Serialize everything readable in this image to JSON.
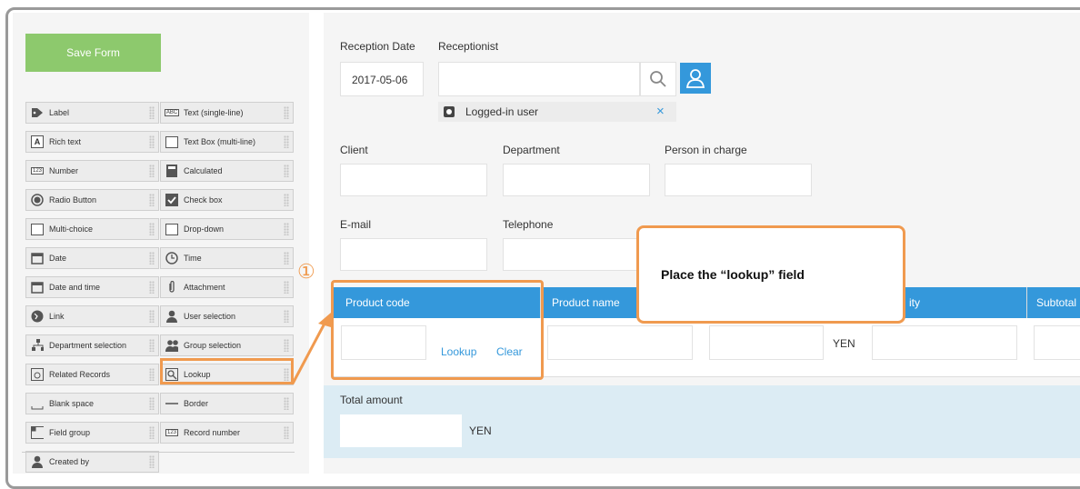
{
  "save_label": "Save Form",
  "palette": [
    {
      "label": "Label",
      "icon": "tag-icon"
    },
    {
      "label": "Text (single-line)",
      "icon": "text-single-icon"
    },
    {
      "label": "Rich text",
      "icon": "rich-text-icon"
    },
    {
      "label": "Text Box (multi-line)",
      "icon": "text-multi-icon"
    },
    {
      "label": "Number",
      "icon": "number-icon"
    },
    {
      "label": "Calculated",
      "icon": "calculator-icon"
    },
    {
      "label": "Radio Button",
      "icon": "radio-icon"
    },
    {
      "label": "Check box",
      "icon": "checkbox-icon"
    },
    {
      "label": "Multi-choice",
      "icon": "multi-choice-icon"
    },
    {
      "label": "Drop-down",
      "icon": "dropdown-icon"
    },
    {
      "label": "Date",
      "icon": "calendar-icon"
    },
    {
      "label": "Time",
      "icon": "clock-icon"
    },
    {
      "label": "Date and time",
      "icon": "calendar-time-icon"
    },
    {
      "label": "Attachment",
      "icon": "paperclip-icon"
    },
    {
      "label": "Link",
      "icon": "globe-icon"
    },
    {
      "label": "User selection",
      "icon": "user-icon"
    },
    {
      "label": "Department selection",
      "icon": "org-icon"
    },
    {
      "label": "Group selection",
      "icon": "group-icon"
    },
    {
      "label": "Related Records",
      "icon": "related-records-icon"
    },
    {
      "label": "Lookup",
      "icon": "lookup-icon"
    },
    {
      "label": "Blank space",
      "icon": "blank-space-icon"
    },
    {
      "label": "Border",
      "icon": "border-line-icon"
    },
    {
      "label": "Field group",
      "icon": "field-group-icon"
    },
    {
      "label": "Record number",
      "icon": "record-number-icon"
    },
    {
      "label": "Created by",
      "icon": "person-icon"
    }
  ],
  "form": {
    "reception_date_label": "Reception Date",
    "reception_date_value": "2017-05-06",
    "receptionist_label": "Receptionist",
    "logged_in_user": "Logged-in user",
    "remove_glyph": "×",
    "client_label": "Client",
    "department_label": "Department",
    "person_label": "Person in charge",
    "email_label": "E-mail",
    "telephone_label": "Telephone",
    "table_headers": [
      "Product code",
      "Product name",
      "ity",
      "Subtotal"
    ],
    "lookup_label": "Lookup",
    "clear_label": "Clear",
    "yen": "YEN",
    "total_label": "Total amount",
    "total_yen": "YEN"
  },
  "annotation": {
    "step": "①",
    "callout": "Place the “lookup” field"
  },
  "colors": {
    "accent": "#3498db",
    "save_green": "#8dc96d",
    "highlight": "#f09a4f"
  }
}
